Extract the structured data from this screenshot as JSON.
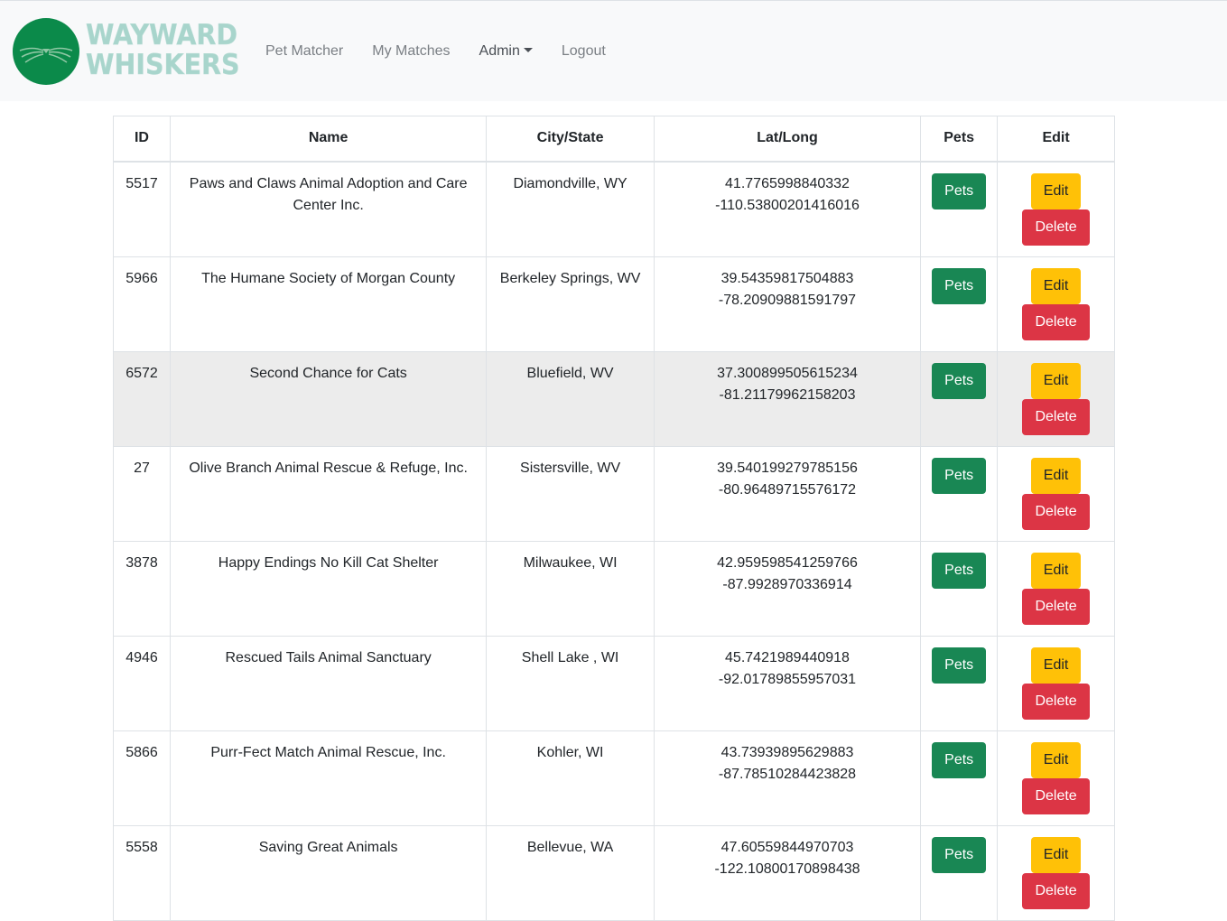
{
  "brand": {
    "line1": "WAYWARD",
    "line2": "WHISKERS",
    "logo_icon": "cat-whiskers-logo-icon",
    "logo_color": "#0b8a4a",
    "text_color": "#a8d5cc"
  },
  "nav": {
    "items": [
      {
        "label": "Pet Matcher"
      },
      {
        "label": "My Matches"
      },
      {
        "label": "Admin"
      },
      {
        "label": "Logout"
      }
    ]
  },
  "table": {
    "headers": [
      "ID",
      "Name",
      "City/State",
      "Lat/Long",
      "Pets",
      "Edit"
    ],
    "rows": [
      {
        "id": "5517",
        "name": "Paws and Claws Animal Adoption and Care Center Inc.",
        "city": "Diamondville, WY",
        "lat": "41.7765998840332",
        "lng": "-110.53800201416016"
      },
      {
        "id": "5966",
        "name": "The Humane Society of Morgan County",
        "city": "Berkeley Springs, WV",
        "lat": "39.54359817504883",
        "lng": "-78.20909881591797"
      },
      {
        "id": "6572",
        "name": "Second Chance for Cats",
        "city": "Bluefield, WV",
        "lat": "37.300899505615234",
        "lng": "-81.21179962158203"
      },
      {
        "id": "27",
        "name": "Olive Branch Animal Rescue & Refuge, Inc.",
        "city": "Sistersville, WV",
        "lat": "39.540199279785156",
        "lng": "-80.96489715576172"
      },
      {
        "id": "3878",
        "name": "Happy Endings No Kill Cat Shelter",
        "city": "Milwaukee, WI",
        "lat": "42.959598541259766",
        "lng": "-87.9928970336914"
      },
      {
        "id": "4946",
        "name": "Rescued Tails Animal Sanctuary",
        "city": "Shell Lake , WI",
        "lat": "45.7421989440918",
        "lng": "-92.01789855957031"
      },
      {
        "id": "5866",
        "name": "Purr-Fect Match Animal Rescue, Inc.",
        "city": "Kohler, WI",
        "lat": "43.73939895629883",
        "lng": "-87.78510284423828"
      },
      {
        "id": "5558",
        "name": "Saving Great Animals",
        "city": "Bellevue, WA",
        "lat": "47.60559844970703",
        "lng": "-122.10800170898438"
      }
    ],
    "highlight_row_index": 2,
    "buttons": {
      "pets_label": "Pets",
      "edit_label": "Edit",
      "delete_label": "Delete"
    },
    "colors": {
      "pets": "#198754",
      "edit": "#ffc107",
      "delete": "#dc3545"
    }
  }
}
